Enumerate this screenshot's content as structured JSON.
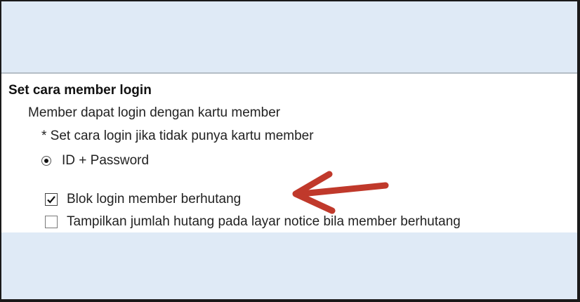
{
  "section": {
    "title": "Set cara member login",
    "option_line": "Member dapat login dengan kartu member",
    "note": "* Set cara login jika tidak punya kartu member"
  },
  "radio": {
    "label": "ID + Password",
    "selected": true
  },
  "checkboxes": [
    {
      "label": "Blok login member berhutang",
      "checked": true
    },
    {
      "label": "Tampilkan jumlah hutang pada layar notice bila member berhutang",
      "checked": false
    }
  ],
  "annotation": {
    "arrow_color": "#c0392b"
  },
  "colors": {
    "background": "#dfeaf6",
    "panel": "#ffffff"
  }
}
